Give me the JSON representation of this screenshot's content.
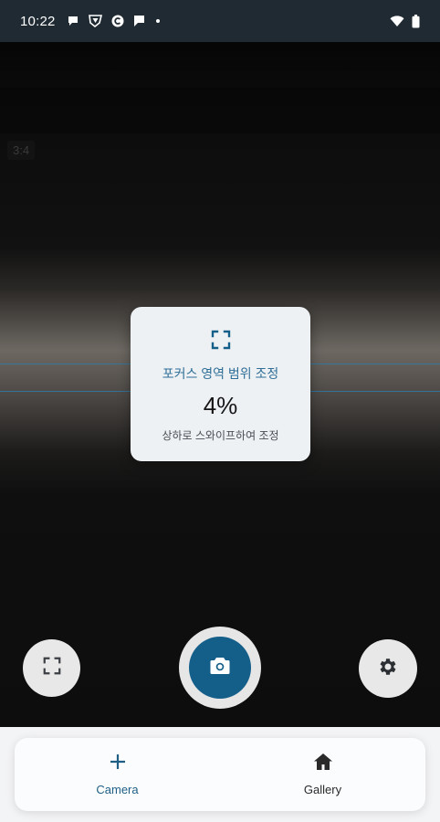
{
  "status_bar": {
    "time": "10:22",
    "notification_icons": [
      "chat-bubble-icon",
      "brand-shield-icon",
      "circle-c-icon",
      "message-icon",
      "dot-icon"
    ],
    "right_icons": [
      "wifi-icon",
      "battery-icon"
    ]
  },
  "preview": {
    "aspect_label": "3:4"
  },
  "focus_dialog": {
    "icon": "focus-frame-icon",
    "title": "포커스 영역 범위 조정",
    "value": "4%",
    "hint": "상하로 스와이프하여 조정"
  },
  "controls": {
    "focus_button_icon": "focus-frame-icon",
    "shutter_icon": "camera-icon",
    "settings_icon": "gear-icon"
  },
  "bottom_nav": {
    "items": [
      {
        "label": "Camera",
        "icon": "plus-icon",
        "active": true
      },
      {
        "label": "Gallery",
        "icon": "home-icon",
        "active": false
      }
    ]
  },
  "colors": {
    "accent": "#145f8a",
    "accent_text": "#2f6f97",
    "guide_line": "#2f79a6",
    "status_bar": "#1f2a33"
  }
}
